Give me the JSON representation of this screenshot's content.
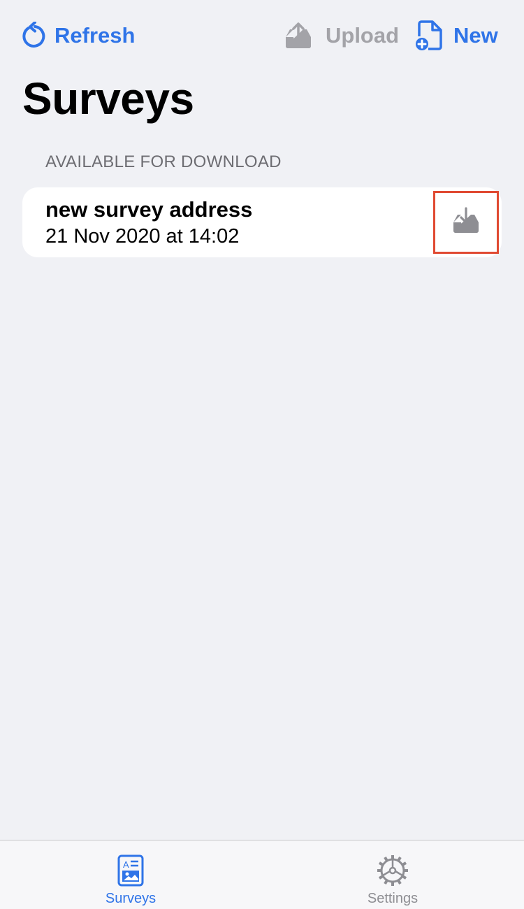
{
  "nav": {
    "refresh_label": "Refresh",
    "upload_label": "Upload",
    "new_label": "New",
    "refresh_icon": "arrow-counterclockwise-icon",
    "upload_icon": "tray-upload-icon",
    "new_icon": "doc-badge-plus-icon"
  },
  "page": {
    "title": "Surveys"
  },
  "sections": [
    {
      "header": "AVAILABLE FOR DOWNLOAD",
      "items": [
        {
          "title": "new survey address",
          "date": "21 Nov 2020 at 14:02",
          "action_icon": "tray-download-icon"
        }
      ]
    }
  ],
  "tabs": [
    {
      "label": "Surveys",
      "icon": "surveys-doc-icon",
      "active": true
    },
    {
      "label": "Settings",
      "icon": "gear-icon",
      "active": false
    }
  ],
  "colors": {
    "accent": "#2f74e8",
    "disabled": "#a3a3a8",
    "background": "#f0f1f5",
    "highlight_box": "#e04a32"
  }
}
